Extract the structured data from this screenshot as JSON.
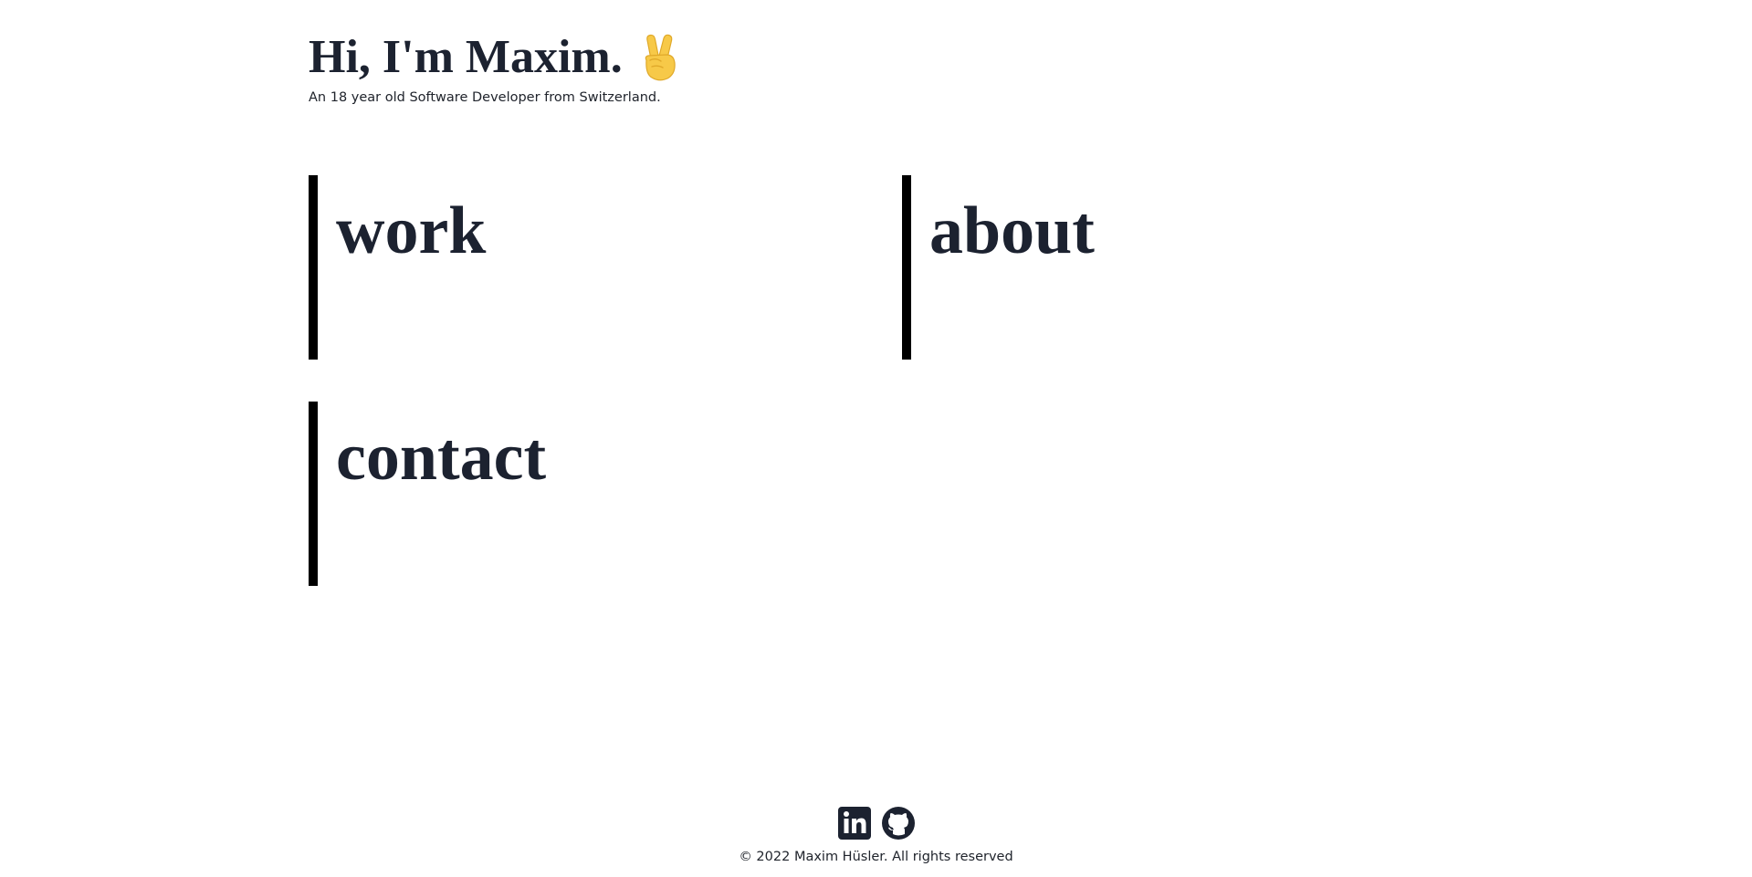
{
  "header": {
    "title": "Hi, I'm Maxim.",
    "emoji_icon": "victory-hand-icon",
    "subtitle": "An 18 year old Software Developer from Switzerland."
  },
  "nav": {
    "work": "work",
    "about": "about",
    "contact": "contact"
  },
  "footer": {
    "social": [
      "linkedin-icon",
      "github-icon"
    ],
    "copyright": "© 2022 Maxim Hüsler. All rights reserved"
  },
  "colors": {
    "text": "#1c2230",
    "accent_bar": "#000000",
    "emoji": "#F5C542",
    "background": "#ffffff"
  }
}
